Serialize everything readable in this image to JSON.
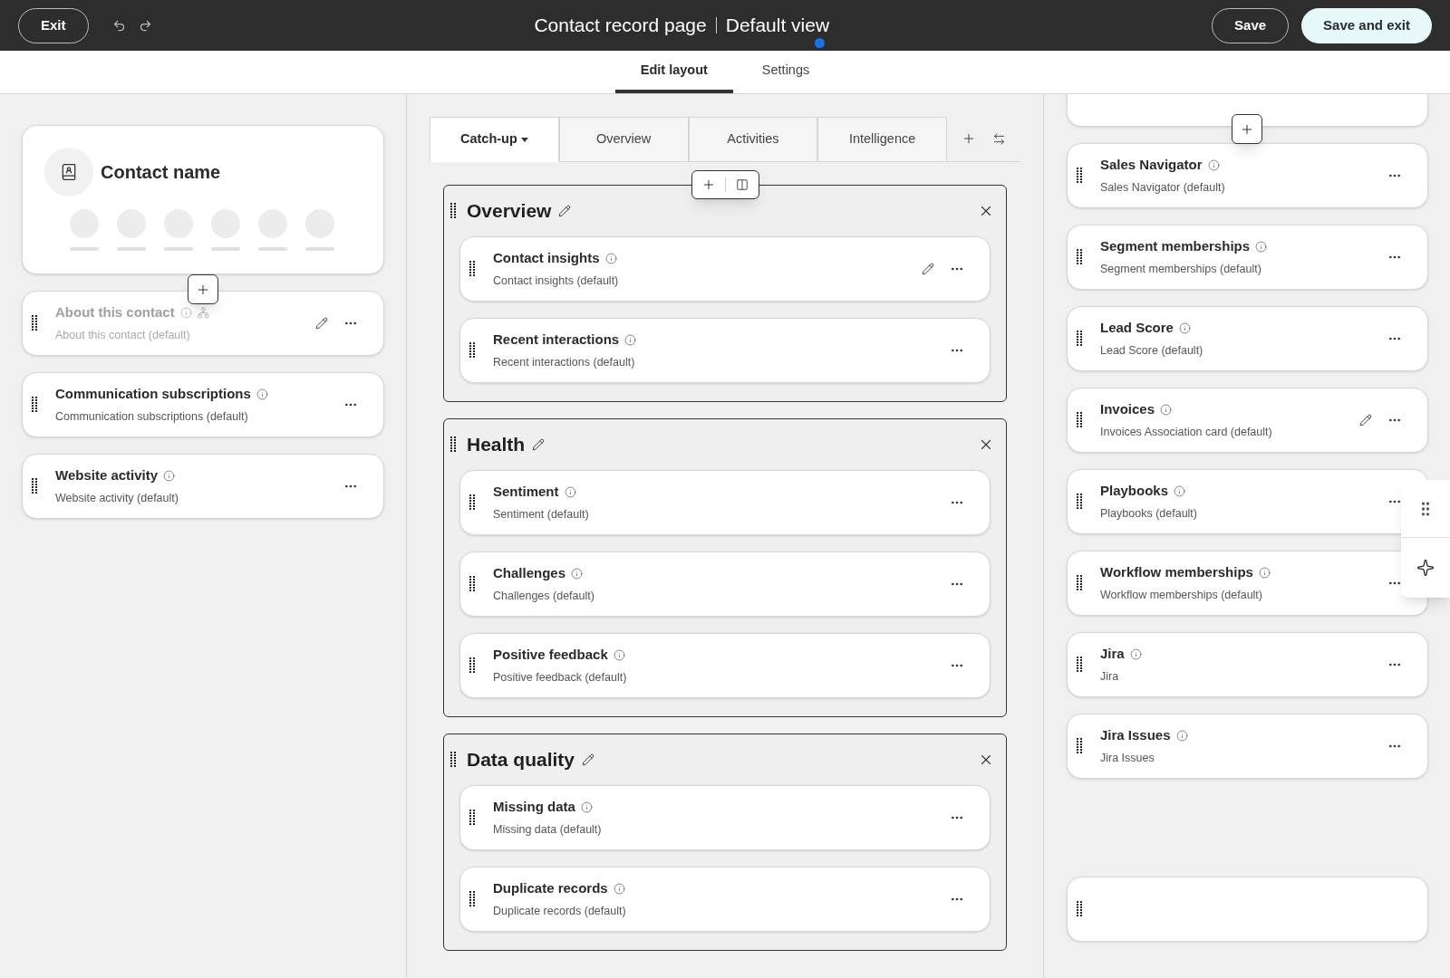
{
  "header": {
    "exit": "Exit",
    "title": "Contact record page",
    "view": "Default view",
    "save": "Save",
    "save_exit": "Save and exit"
  },
  "tabs": [
    {
      "label": "Edit layout",
      "selected": true
    },
    {
      "label": "Settings",
      "selected": false
    }
  ],
  "left": {
    "contact_title": "Contact name",
    "cards": [
      {
        "kind": "card",
        "title": "About this contact",
        "subtitle": "About this contact (default)",
        "dimmed": true,
        "hierarchy": true,
        "editable": true
      },
      {
        "kind": "card",
        "title": "Communication subscriptions",
        "subtitle": "Communication subscriptions (default)",
        "dimmed": false,
        "hierarchy": false,
        "editable": false
      },
      {
        "kind": "card",
        "title": "Website activity",
        "subtitle": "Website activity (default)",
        "dimmed": false,
        "hierarchy": false,
        "editable": false
      }
    ]
  },
  "record_tabs": [
    {
      "label": "Catch-up",
      "selected": true
    },
    {
      "label": "Overview",
      "selected": false
    },
    {
      "label": "Activities",
      "selected": false
    },
    {
      "label": "Intelligence",
      "selected": false
    }
  ],
  "sections": [
    {
      "title": "Overview",
      "cards": [
        {
          "kind": "card",
          "title": "Contact insights",
          "subtitle": "Contact insights (default)",
          "dimmed": false,
          "hierarchy": false,
          "editable": true
        },
        {
          "kind": "card",
          "title": "Recent interactions",
          "subtitle": "Recent interactions (default)",
          "dimmed": false,
          "hierarchy": false,
          "editable": false
        }
      ]
    },
    {
      "title": "Health",
      "cards": [
        {
          "kind": "card",
          "title": "Sentiment",
          "subtitle": "Sentiment (default)",
          "dimmed": false,
          "hierarchy": false,
          "editable": false
        },
        {
          "kind": "card",
          "title": "Challenges",
          "subtitle": "Challenges (default)",
          "dimmed": false,
          "hierarchy": false,
          "editable": false
        },
        {
          "kind": "card",
          "title": "Positive feedback",
          "subtitle": "Positive feedback (default)",
          "dimmed": false,
          "hierarchy": false,
          "editable": false
        }
      ]
    },
    {
      "title": "Data quality",
      "cards": [
        {
          "kind": "card",
          "title": "Missing data",
          "subtitle": "Missing data (default)",
          "dimmed": false,
          "hierarchy": false,
          "editable": false
        },
        {
          "kind": "card",
          "title": "Duplicate records",
          "subtitle": "Duplicate records (default)",
          "dimmed": false,
          "hierarchy": false,
          "editable": false
        }
      ]
    }
  ],
  "right": {
    "cards": [
      {
        "kind": "partial"
      },
      {
        "kind": "card",
        "title": "Sales Navigator",
        "subtitle": "Sales Navigator (default)",
        "dimmed": false,
        "hierarchy": false,
        "editable": false
      },
      {
        "kind": "card",
        "title": "Segment memberships",
        "subtitle": "Segment memberships (default)",
        "dimmed": false,
        "hierarchy": false,
        "editable": false
      },
      {
        "kind": "card",
        "title": "Lead Score",
        "subtitle": "Lead Score (default)",
        "dimmed": false,
        "hierarchy": false,
        "editable": false
      },
      {
        "kind": "card",
        "title": "Invoices",
        "subtitle": "Invoices Association card (default)",
        "dimmed": false,
        "hierarchy": false,
        "editable": true
      },
      {
        "kind": "card",
        "title": "Playbooks",
        "subtitle": "Playbooks (default)",
        "dimmed": false,
        "hierarchy": false,
        "editable": false
      },
      {
        "kind": "card",
        "title": "Workflow memberships",
        "subtitle": "Workflow memberships (default)",
        "dimmed": false,
        "hierarchy": false,
        "editable": false
      },
      {
        "kind": "card",
        "title": "Jira",
        "subtitle": "Jira",
        "dimmed": false,
        "hierarchy": false,
        "editable": false
      },
      {
        "kind": "card",
        "title": "Jira Issues",
        "subtitle": "Jira Issues",
        "dimmed": false,
        "hierarchy": false,
        "editable": false
      },
      {
        "kind": "empty"
      }
    ]
  }
}
